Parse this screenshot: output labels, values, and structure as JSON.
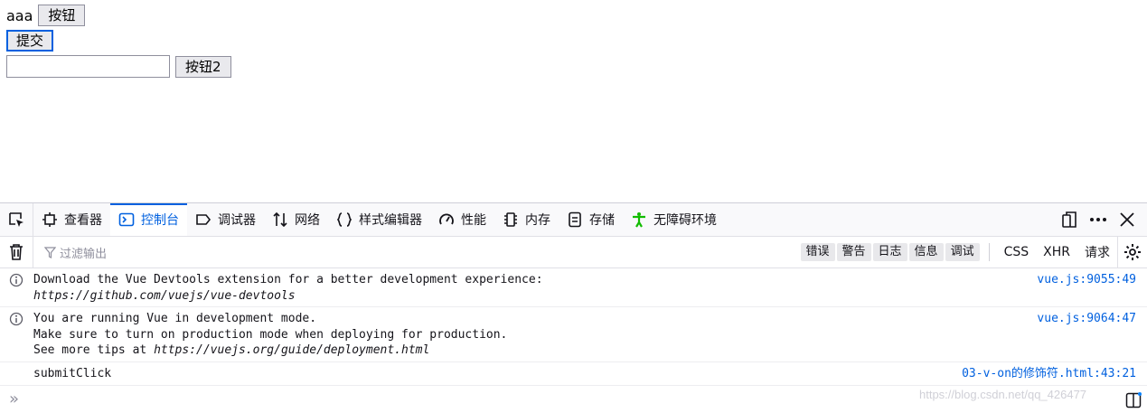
{
  "page": {
    "text_aaa": "aaa",
    "button1_label": "按钮",
    "submit_label": "提交",
    "input_value": "",
    "button2_label": "按钮2"
  },
  "devtools": {
    "tabs": [
      {
        "label": "查看器",
        "icon": "inspector-icon"
      },
      {
        "label": "控制台",
        "icon": "console-icon",
        "active": true
      },
      {
        "label": "调试器",
        "icon": "debugger-icon"
      },
      {
        "label": "网络",
        "icon": "network-icon"
      },
      {
        "label": "样式编辑器",
        "icon": "style-editor-icon"
      },
      {
        "label": "性能",
        "icon": "performance-icon"
      },
      {
        "label": "内存",
        "icon": "memory-icon"
      },
      {
        "label": "存储",
        "icon": "storage-icon"
      },
      {
        "label": "无障碍环境",
        "icon": "accessibility-icon"
      }
    ],
    "filter_placeholder": "过滤输出",
    "levels": [
      "错误",
      "警告",
      "日志",
      "信息",
      "调试"
    ],
    "requests": [
      "CSS",
      "XHR",
      "请求"
    ],
    "messages": [
      {
        "lines": [
          "Download the Vue Devtools extension for a better development experience:",
          "https://github.com/vuejs/vue-devtools"
        ],
        "location": "vue.js:9055:49"
      },
      {
        "lines": [
          "You are running Vue in development mode.",
          "Make sure to turn on production mode when deploying for production.",
          "See more tips at ",
          "https://vuejs.org/guide/deployment.html"
        ],
        "location": "vue.js:9064:47"
      },
      {
        "lines": [
          "submitClick"
        ],
        "location": "03-v-on的修饰符.html:43:21"
      }
    ],
    "prompt_symbol": "»",
    "watermark": "https://blog.csdn.net/qq_426477"
  },
  "colors": {
    "accent": "#0060df",
    "info_icon": "#5b5b66",
    "accessibility": "#12bc00"
  }
}
